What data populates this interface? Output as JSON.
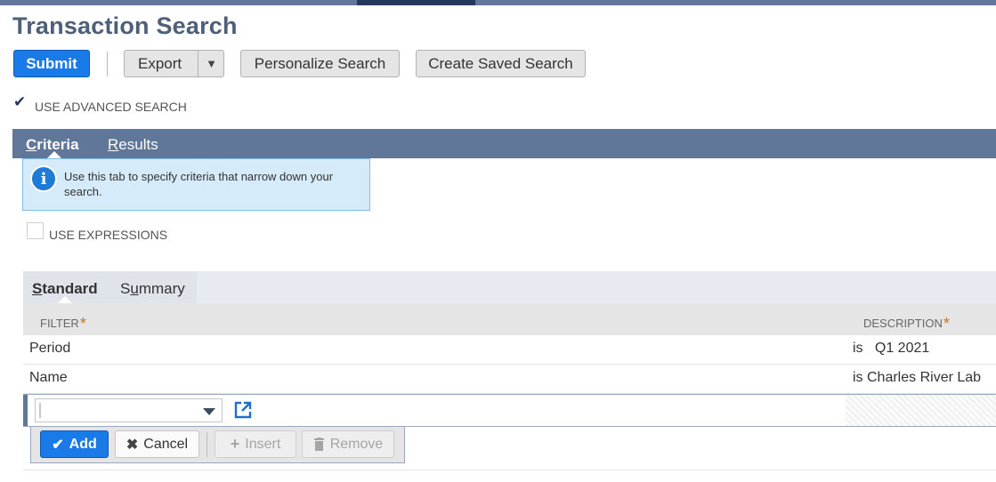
{
  "page": {
    "title": "Transaction Search"
  },
  "toolbar": {
    "submit": "Submit",
    "export": "Export",
    "personalize": "Personalize Search",
    "create_saved": "Create Saved Search"
  },
  "advanced": {
    "label": "USE ADVANCED SEARCH",
    "checked": true
  },
  "tabs": [
    {
      "prefix": "",
      "key": "C",
      "rest": "riteria",
      "active": true
    },
    {
      "prefix": "",
      "key": "R",
      "rest": "esults",
      "active": false
    }
  ],
  "info": {
    "text": "Use this tab to specify criteria that narrow down your search."
  },
  "expressions": {
    "label": "USE EXPRESSIONS",
    "checked": false
  },
  "subtabs": [
    {
      "prefix": "",
      "key": "S",
      "rest": "tandard",
      "active": true
    },
    {
      "prefix": "S",
      "key": "u",
      "rest": "mmary",
      "active": false
    }
  ],
  "table": {
    "columns": {
      "filter": "FILTER",
      "description": "DESCRIPTION",
      "required_mark": "*"
    },
    "rows": [
      {
        "filter": "Period",
        "description": "is   Q1 2021"
      },
      {
        "filter": "Name",
        "description": "is Charles River Lab"
      }
    ]
  },
  "actions": {
    "add": "Add",
    "cancel": "Cancel",
    "insert": "Insert",
    "remove": "Remove"
  },
  "colors": {
    "accent": "#1a7be8",
    "tabbar": "#607799",
    "title": "#4d5f79"
  }
}
